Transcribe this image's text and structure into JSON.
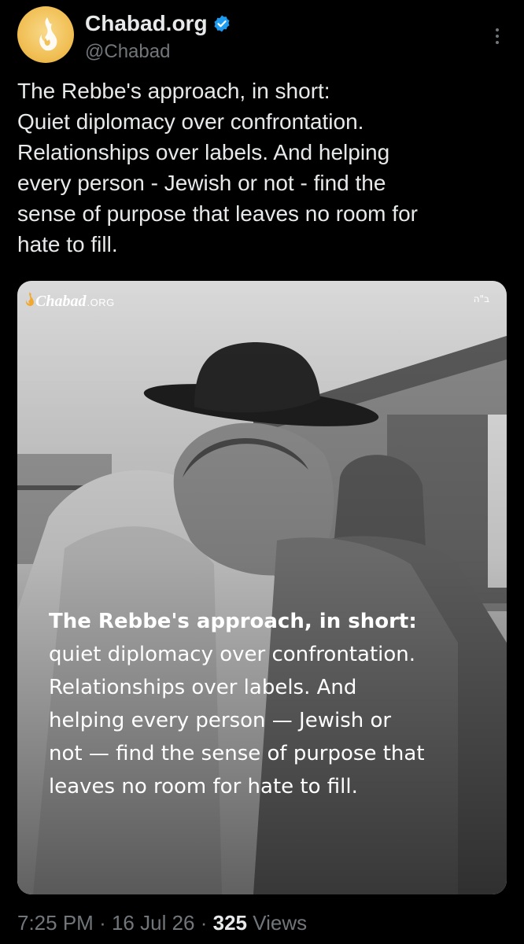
{
  "author": {
    "display_name": "Chabad.org",
    "handle": "@Chabad",
    "verified": true,
    "avatar_icon": "chabad-flame-logo"
  },
  "tweet": {
    "text_lines": [
      "The Rebbe's approach, in short:",
      "Quiet diplomacy over confrontation.",
      "Relationships over labels. And helping",
      "every person - Jewish or not - find the",
      "sense of purpose that leaves no room for",
      "hate to fill."
    ]
  },
  "media": {
    "logo_text": "Chabad",
    "logo_suffix": ".ORG",
    "corner_mark": "ב\"ה",
    "overlay_heading": "The Rebbe's approach, in short:",
    "overlay_lines": [
      "quiet diplomacy over confrontation.",
      "Relationships over labels. And",
      "helping every person — Jewish or",
      "not — find the sense of purpose that",
      "leaves no room for hate to fill."
    ]
  },
  "meta": {
    "time": "7:25 PM",
    "separator": "·",
    "date": "16 Jul 26",
    "views_count": "325",
    "views_label": "Views"
  },
  "colors": {
    "background": "#000000",
    "primary_text": "#e7e9ea",
    "secondary_text": "#71767b",
    "verified_blue": "#1d9bf0",
    "avatar_gold": "#f2c25a"
  }
}
